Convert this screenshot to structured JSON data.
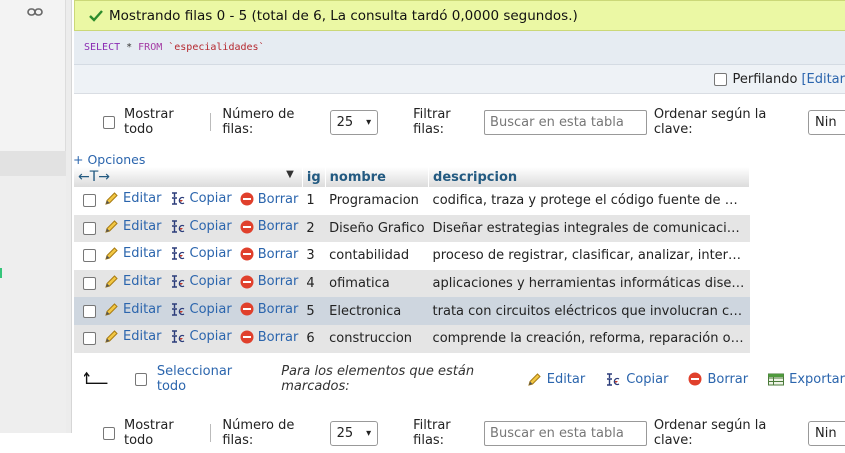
{
  "banner": {
    "message": "Mostrando filas 0 - 5 (total de 6, La consulta tardó 0,0000 segundos.)"
  },
  "sql": {
    "select": "SELECT",
    "star": "*",
    "from": "FROM",
    "table": "`especialidades`"
  },
  "profiling": {
    "label": "Perfilando",
    "edit_link": "[Editar"
  },
  "controls": {
    "show_all": "Mostrar todo",
    "rows_label": "Número de filas:",
    "rows_value": "25",
    "filter_label": "Filtrar filas:",
    "filter_placeholder": "Buscar en esta tabla",
    "sort_label": "Ordenar según la clave:",
    "sort_value": "Nin"
  },
  "options_link": "+ Opciones",
  "table": {
    "arrows": "←T→",
    "columns": [
      "ig",
      "nombre",
      "descripcion"
    ],
    "actions": {
      "edit": "Editar",
      "copy": "Copiar",
      "delete": "Borrar"
    },
    "rows": [
      {
        "id": "1",
        "nombre": "Programacion",
        "descripcion": "codifica, traza y protege el código fuente de prog..."
      },
      {
        "id": "2",
        "nombre": "Diseño Grafico",
        "descripcion": "Diseñar estrategias integrales de comunicación vis..."
      },
      {
        "id": "3",
        "nombre": "contabilidad",
        "descripcion": "proceso de registrar, clasificar, analizar, interp..."
      },
      {
        "id": "4",
        "nombre": "ofimatica",
        "descripcion": "aplicaciones y herramientas informáticas diseñadas..."
      },
      {
        "id": "5",
        "nombre": "Electronica",
        "descripcion": "trata con circuitos eléctricos que involucran comp..."
      },
      {
        "id": "6",
        "nombre": "construccion",
        "descripcion": "comprende la creación, reforma, reparación o ampli..."
      }
    ]
  },
  "bulk": {
    "select_all": "Seleccionar todo",
    "marked_label": "Para los elementos que están marcados:",
    "edit": "Editar",
    "copy": "Copiar",
    "delete": "Borrar",
    "export": "Exportar"
  },
  "colors": {
    "banner_bg": "#ebf8a4",
    "link": "#2b65ad",
    "header_text": "#235a81",
    "hover_row": "#ced6df"
  }
}
